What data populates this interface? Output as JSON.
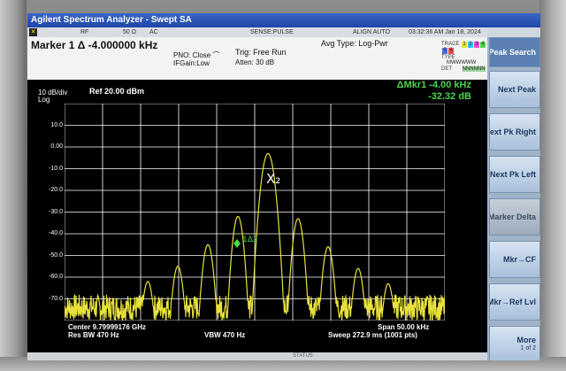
{
  "window": {
    "title": "Agilent Spectrum Analyzer - Swept SA"
  },
  "status_row": {
    "rf": "RF",
    "impedance": "50 Ω",
    "coupling": "AC",
    "sense": "SENSE:PULSE",
    "align": "ALIGN AUTO",
    "timestamp": "03:32:36 AM Jan 18, 2024"
  },
  "header": {
    "marker": "Marker 1 Δ -4.000000 kHz",
    "pno": "PNO: Close",
    "ifgain": "IFGain:Low",
    "trig": "Trig: Free Run",
    "atten": "Atten: 30 dB",
    "avg_type": "Avg Type: Log-Pwr",
    "trace_label": "TRACE",
    "trace_numbers": [
      "1",
      "2",
      "3",
      "4",
      "5",
      "6"
    ],
    "type_label": "TYPE",
    "type_value": "MWWWWW",
    "det_label": "DET",
    "det_value": "NNNNNN"
  },
  "plot": {
    "scale": "10 dB/div",
    "scale_type": "Log",
    "ref": "Ref 20.00 dBm",
    "marker_readout_line1": "ΔMkr1 -4.00 kHz",
    "marker_readout_line2": "-32.32 dB",
    "marker_x2_label": "X₂",
    "marker_1d2_label": "1Δ2",
    "y_ticks": [
      "10.0",
      "0.00",
      "-10.0",
      "-20.0",
      "-30.0",
      "-40.0",
      "-50.0",
      "-60.0",
      "-70.0"
    ],
    "center": "Center 9.79999176 GHz",
    "res_bw": "Res BW 470 Hz",
    "vbw": "VBW 470 Hz",
    "span": "Span 50.00 kHz",
    "sweep": "Sweep  272.9 ms (1001 pts)"
  },
  "softkeys": {
    "title": "Peak Search",
    "items": [
      "Next Peak",
      "Next Pk Right",
      "Next Pk Left",
      "Marker Delta",
      "Mkr→CF",
      "Mkr→Ref Lvl"
    ],
    "more": "More",
    "more_page": "1 of 2"
  },
  "statusbar": {
    "status": "STATUS"
  },
  "colors": {
    "trace": "#e8e23a",
    "marker": "#4bd64b",
    "grid": "#ffffff",
    "background": "#000000"
  }
}
